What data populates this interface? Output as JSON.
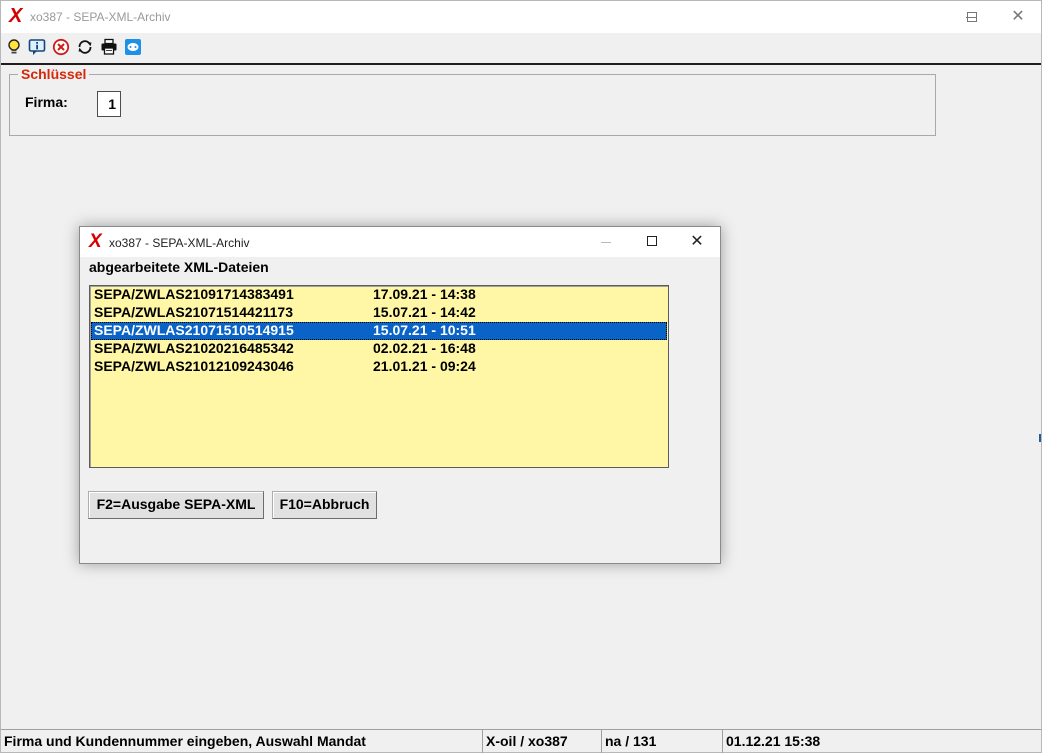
{
  "main_window": {
    "title": "xo387 - SEPA-XML-Archiv",
    "app_logo": "X",
    "controls": [
      "minimize-icon",
      "maximize-icon",
      "close-icon"
    ]
  },
  "toolbar": {
    "icons": [
      "lightbulb-icon",
      "info-icon",
      "cancel-icon",
      "refresh-icon",
      "print-icon",
      "chat-icon"
    ]
  },
  "schluessel": {
    "legend": "Schlüssel",
    "firma_label": "Firma:",
    "firma_value": "1"
  },
  "dialog": {
    "title": "xo387 - SEPA-XML-Archiv",
    "app_logo": "X",
    "caption": "abgearbeitete XML-Dateien",
    "rows": [
      {
        "file": "SEPA/ZWLAS21091714383491",
        "datetime": "17.09.21 - 14:38",
        "selected": false
      },
      {
        "file": "SEPA/ZWLAS21071514421173",
        "datetime": "15.07.21 - 14:42",
        "selected": false
      },
      {
        "file": "SEPA/ZWLAS21071510514915",
        "datetime": "15.07.21 - 10:51",
        "selected": true
      },
      {
        "file": "SEPA/ZWLAS21020216485342",
        "datetime": "02.02.21 - 16:48",
        "selected": false
      },
      {
        "file": "SEPA/ZWLAS21012109243046",
        "datetime": "21.01.21 - 09:24",
        "selected": false
      }
    ],
    "buttons": {
      "f2": "F2=Ausgabe SEPA-XML",
      "f10": "F10=Abbruch"
    }
  },
  "statusbar": {
    "message": "Firma und Kundennummer eingeben, Auswahl Mandat",
    "app": "X-oil / xo387",
    "user": "na / 131",
    "datetime": "01.12.21 15:38"
  },
  "colors": {
    "accent_red": "#d40000",
    "legend_red": "#d42a0a",
    "list_background": "#fff7a6",
    "selection_blue": "#0a64c8"
  }
}
